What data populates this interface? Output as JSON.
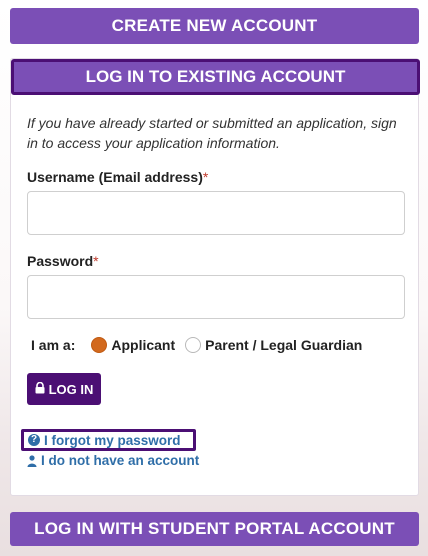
{
  "create_account": {
    "label": "CREATE NEW ACCOUNT"
  },
  "login_panel": {
    "title": "LOG IN TO EXISTING ACCOUNT",
    "intro": "If you have already started or submitted an application, sign in to access your application information.",
    "username_label": "Username (Email address)",
    "username_value": "",
    "password_label": "Password",
    "password_value": "",
    "required_mark": "*",
    "role_label": "I am a:",
    "roles": [
      {
        "label": "Applicant",
        "selected": true
      },
      {
        "label": "Parent / Legal Guardian",
        "selected": false
      }
    ],
    "login_button": "LOG IN",
    "forgot_link": "I forgot my password",
    "no_account_link": "I do not have an account"
  },
  "portal_button": {
    "label": "LOG IN WITH STUDENT PORTAL ACCOUNT"
  },
  "colors": {
    "accent_purple": "#7b4fb6",
    "dark_purple": "#4b0f74",
    "link_blue": "#2f6ea8",
    "radio_selected": "#d2691e"
  }
}
